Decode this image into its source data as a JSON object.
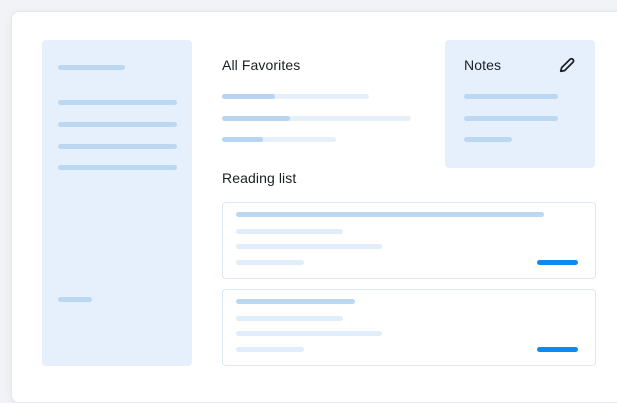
{
  "favorites": {
    "title": "All Favorites"
  },
  "notes": {
    "title": "Notes",
    "edit_icon": "pencil-icon"
  },
  "reading_list": {
    "title": "Reading list"
  },
  "colors": {
    "accent": "#0d8af0",
    "panel": "#e5f0fc",
    "placeholder": "#bcd7f1"
  }
}
